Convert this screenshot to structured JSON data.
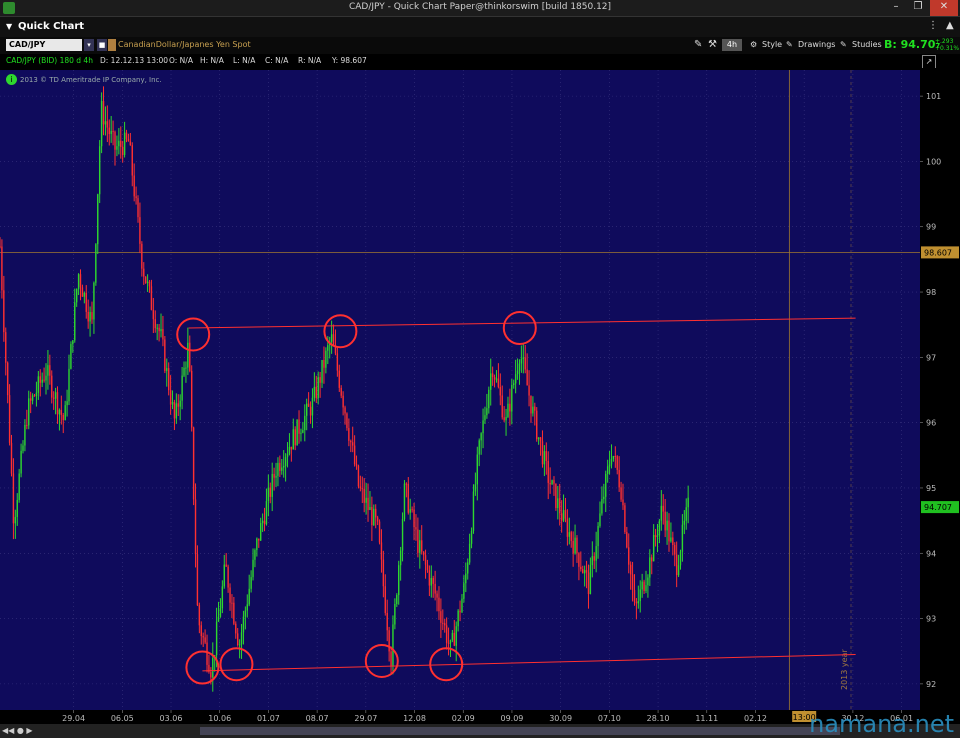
{
  "window": {
    "title": "CAD/JPY - Quick Chart Paper@thinkorswim [build 1850.12]",
    "panel_title": "Quick Chart"
  },
  "toolbar": {
    "symbol": "CAD/JPY",
    "description": "CanadianDollar/Japanes Yen Spot",
    "timeframe": "4h",
    "style_label": "Style",
    "drawings_label": "Drawings",
    "studies_label": "Studies",
    "bid": "B: 94.70",
    "bid_sub": "7",
    "change": "+.293",
    "change_pct": "+0.31%"
  },
  "infobar": {
    "symbol_period": "CAD/JPY (BID) 180 d 4h",
    "date": "D: 12.12.13 13:00",
    "open": "O: N/A",
    "high": "H: N/A",
    "low": "L: N/A",
    "close": "C: N/A",
    "range": "R: N/A",
    "y": "Y: 98.607"
  },
  "copyright": "2013 © TD Ameritrade IP Company, Inc.",
  "colors": {
    "background": "#0f0b5c",
    "up": "#2ed82e",
    "down": "#ff3030",
    "trend": "#ff3030",
    "crosshair": "#a07830"
  },
  "chart_data": {
    "type": "candlestick",
    "y_ticks": [
      101,
      100,
      99,
      98,
      97,
      96,
      95,
      94,
      93,
      92
    ],
    "ylim": [
      91.6,
      101.4
    ],
    "x_ticks": [
      "29.04",
      "06.05",
      "03.06",
      "10.06",
      "01.07",
      "08.07",
      "29.07",
      "12.08",
      "02.09",
      "09.09",
      "30.09",
      "07.10",
      "28.10",
      "11.11",
      "02.12",
      "13:00",
      "30.12",
      "06.01"
    ],
    "crosshair_price": "98.607",
    "last_price": "94.707",
    "year_marker": "2013 year",
    "x_axis_time": "13:00",
    "price_path": [
      {
        "t": 0,
        "y": 98.7
      },
      {
        "t": 0.015,
        "y": 94.5
      },
      {
        "t": 0.03,
        "y": 96.2
      },
      {
        "t": 0.05,
        "y": 96.8
      },
      {
        "t": 0.07,
        "y": 96.0
      },
      {
        "t": 0.085,
        "y": 98.3
      },
      {
        "t": 0.1,
        "y": 97.5
      },
      {
        "t": 0.11,
        "y": 100.8
      },
      {
        "t": 0.125,
        "y": 100.2
      },
      {
        "t": 0.14,
        "y": 100.3
      },
      {
        "t": 0.155,
        "y": 98.4
      },
      {
        "t": 0.165,
        "y": 97.8
      },
      {
        "t": 0.175,
        "y": 97.3
      },
      {
        "t": 0.19,
        "y": 96.0
      },
      {
        "t": 0.205,
        "y": 97.2
      },
      {
        "t": 0.215,
        "y": 93.0
      },
      {
        "t": 0.23,
        "y": 92.2
      },
      {
        "t": 0.245,
        "y": 93.8
      },
      {
        "t": 0.26,
        "y": 92.6
      },
      {
        "t": 0.28,
        "y": 94.2
      },
      {
        "t": 0.3,
        "y": 95.3
      },
      {
        "t": 0.32,
        "y": 95.8
      },
      {
        "t": 0.34,
        "y": 96.3
      },
      {
        "t": 0.36,
        "y": 97.3
      },
      {
        "t": 0.375,
        "y": 96.2
      },
      {
        "t": 0.39,
        "y": 95.0
      },
      {
        "t": 0.41,
        "y": 94.4
      },
      {
        "t": 0.425,
        "y": 92.4
      },
      {
        "t": 0.44,
        "y": 95.0
      },
      {
        "t": 0.455,
        "y": 94.1
      },
      {
        "t": 0.475,
        "y": 93.3
      },
      {
        "t": 0.49,
        "y": 92.5
      },
      {
        "t": 0.505,
        "y": 93.5
      },
      {
        "t": 0.52,
        "y": 95.5
      },
      {
        "t": 0.535,
        "y": 96.9
      },
      {
        "t": 0.55,
        "y": 96.0
      },
      {
        "t": 0.565,
        "y": 97.1
      },
      {
        "t": 0.58,
        "y": 96.1
      },
      {
        "t": 0.595,
        "y": 95.2
      },
      {
        "t": 0.61,
        "y": 94.6
      },
      {
        "t": 0.625,
        "y": 94.1
      },
      {
        "t": 0.64,
        "y": 93.5
      },
      {
        "t": 0.655,
        "y": 94.8
      },
      {
        "t": 0.665,
        "y": 95.6
      },
      {
        "t": 0.675,
        "y": 95.0
      },
      {
        "t": 0.69,
        "y": 93.1
      },
      {
        "t": 0.705,
        "y": 93.8
      },
      {
        "t": 0.72,
        "y": 94.7
      },
      {
        "t": 0.735,
        "y": 93.8
      },
      {
        "t": 0.748,
        "y": 94.7
      }
    ],
    "trendlines": [
      {
        "from": {
          "t": 0.205,
          "y": 97.45
        },
        "to": {
          "t": 0.93,
          "y": 97.6
        }
      },
      {
        "from": {
          "t": 0.22,
          "y": 92.2
        },
        "to": {
          "t": 0.93,
          "y": 92.45
        }
      }
    ],
    "circles": [
      {
        "t": 0.21,
        "y": 97.35
      },
      {
        "t": 0.37,
        "y": 97.4
      },
      {
        "t": 0.565,
        "y": 97.45
      },
      {
        "t": 0.22,
        "y": 92.25
      },
      {
        "t": 0.257,
        "y": 92.3
      },
      {
        "t": 0.415,
        "y": 92.35
      },
      {
        "t": 0.485,
        "y": 92.3
      }
    ]
  },
  "watermark": "namana.net"
}
